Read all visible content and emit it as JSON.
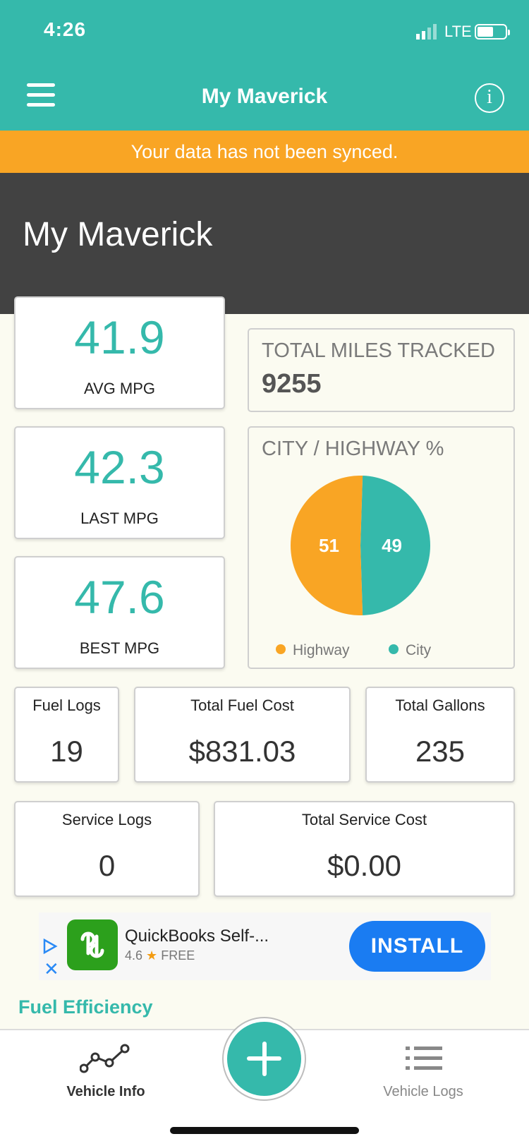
{
  "status_bar": {
    "time": "4:26",
    "network": "LTE"
  },
  "header": {
    "title": "My Maverick",
    "info_icon": "i"
  },
  "sync_banner": "Your data has not been synced.",
  "vehicle_name": "My Maverick",
  "mpg_cards": [
    {
      "value": "41.9",
      "label": "AVG MPG"
    },
    {
      "value": "42.3",
      "label": "LAST MPG"
    },
    {
      "value": "47.6",
      "label": "BEST MPG"
    }
  ],
  "total_miles": {
    "label": "TOTAL MILES TRACKED",
    "value": "9255"
  },
  "city_highway": {
    "title": "CITY / HIGHWAY %",
    "chart_data": {
      "type": "pie",
      "title": "CITY / HIGHWAY %",
      "categories": [
        "Highway",
        "City"
      ],
      "values": [
        51,
        49
      ],
      "colors": [
        "#f9a524",
        "#35b9ab"
      ],
      "legend": "bottom"
    }
  },
  "stats_row1": [
    {
      "label": "Fuel Logs",
      "value": "19"
    },
    {
      "label": "Total Fuel Cost",
      "value": "$831.03"
    },
    {
      "label": "Total Gallons",
      "value": "235"
    }
  ],
  "stats_row2": [
    {
      "label": "Service Logs",
      "value": "0"
    },
    {
      "label": "Total Service Cost",
      "value": "$0.00"
    }
  ],
  "ad": {
    "app_name": "QuickBooks Self-...",
    "rating": "4.6",
    "price": "FREE",
    "cta": "INSTALL",
    "close": "✕"
  },
  "section_title": "Fuel Efficiency",
  "nav": {
    "vehicle_info": "Vehicle Info",
    "vehicle_logs": "Vehicle Logs"
  },
  "colors": {
    "primary": "#35b9ab",
    "warning": "#f9a524",
    "hero": "#424242",
    "install": "#1a7cf2"
  }
}
